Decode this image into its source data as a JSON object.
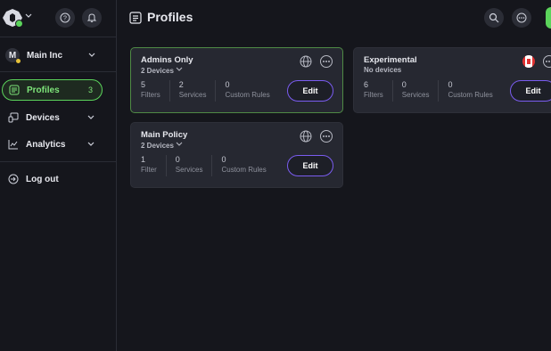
{
  "sidebar": {
    "org": {
      "initial": "M",
      "name": "Main Inc"
    },
    "nav": [
      {
        "label": "Profiles",
        "count": "3"
      },
      {
        "label": "Devices"
      },
      {
        "label": "Analytics"
      },
      {
        "label": "Log out"
      }
    ]
  },
  "header": {
    "title": "Profiles"
  },
  "profiles": [
    {
      "name": "Admins Only",
      "devices": "2 Devices",
      "stats": [
        {
          "n": "5",
          "l": "Filters"
        },
        {
          "n": "2",
          "l": "Services"
        },
        {
          "n": "0",
          "l": "Custom Rules"
        }
      ],
      "edit": "Edit"
    },
    {
      "name": "Experimental",
      "devices": "No devices",
      "stats": [
        {
          "n": "6",
          "l": "Filters"
        },
        {
          "n": "0",
          "l": "Services"
        },
        {
          "n": "0",
          "l": "Custom Rules"
        }
      ],
      "edit": "Edit"
    },
    {
      "name": "Main Policy",
      "devices": "2 Devices",
      "stats": [
        {
          "n": "1",
          "l": "Filter"
        },
        {
          "n": "0",
          "l": "Services"
        },
        {
          "n": "0",
          "l": "Custom Rules"
        }
      ],
      "edit": "Edit"
    }
  ],
  "colors": {
    "accent_green": "#5bd45b",
    "edit_border": "#7a5cf0",
    "background": "#15161c",
    "card": "#262831"
  }
}
